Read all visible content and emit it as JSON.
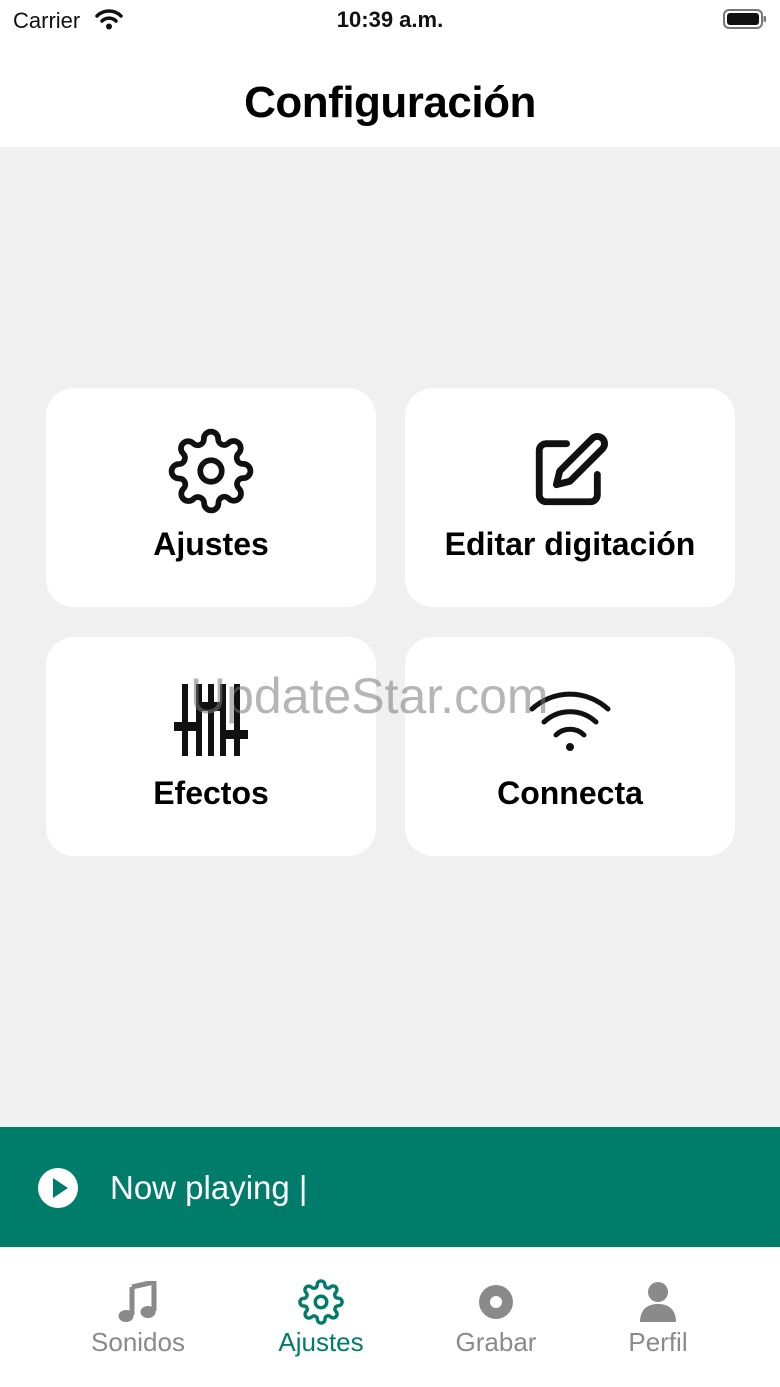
{
  "status_bar": {
    "carrier": "Carrier",
    "time": "10:39 a.m.",
    "wifi_icon": "wifi-icon",
    "battery_icon": "battery-icon"
  },
  "header": {
    "title": "Configuración"
  },
  "cards": [
    {
      "label": "Ajustes",
      "icon": "gear-icon"
    },
    {
      "label": "Editar digitación",
      "icon": "edit-icon"
    },
    {
      "label": "Efectos",
      "icon": "sliders-icon"
    },
    {
      "label": "Connecta",
      "icon": "wifi-icon"
    }
  ],
  "watermark": "UpdateStar.com",
  "now_playing": {
    "text": "Now playing |",
    "icon": "play-circle-icon"
  },
  "tab_bar": {
    "items": [
      {
        "label": "Sonidos",
        "icon": "music-note-icon",
        "active": false
      },
      {
        "label": "Ajustes",
        "icon": "gear-icon",
        "active": true
      },
      {
        "label": "Grabar",
        "icon": "record-icon",
        "active": false
      },
      {
        "label": "Perfil",
        "icon": "person-icon",
        "active": false
      }
    ]
  },
  "colors": {
    "accent": "#007c6b",
    "background": "#f0f0f0",
    "card": "#ffffff",
    "inactive_tab": "#8a8a8a"
  }
}
